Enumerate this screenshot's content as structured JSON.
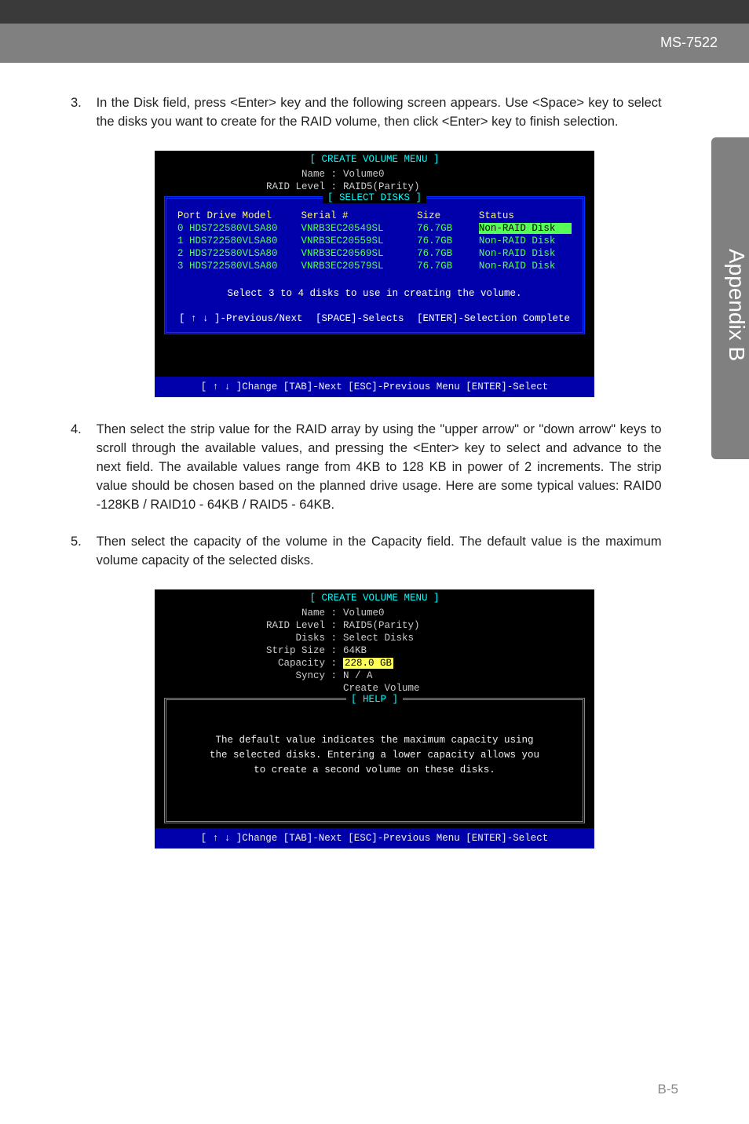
{
  "header": {
    "title": "MS-7522"
  },
  "sideTab": "Appendix B",
  "step3": {
    "num": "3.",
    "text": "In the Disk field, press <Enter> key and the following screen appears. Use <Space> key to select the disks you want to create for the RAID volume, then click <Enter> key to finish selection."
  },
  "bios1": {
    "title": "[ CREATE VOLUME MENU ]",
    "fields": [
      {
        "label": "Name :",
        "value": "Volume0"
      },
      {
        "label": "RAID Level :",
        "value": "RAID5(Parity)"
      }
    ],
    "selectTitle": "[ SELECT DISKS ]",
    "headers": {
      "port": "Port Drive Model",
      "serial": "Serial #",
      "size": "Size",
      "status": "Status"
    },
    "rows": [
      {
        "port": "0 HDS722580VLSA80",
        "serial": "VNRB3EC20549SL",
        "size": "76.7GB",
        "status": "Non-RAID Disk",
        "hl": true
      },
      {
        "port": "1 HDS722580VLSA80",
        "serial": "VNRB3EC20559SL",
        "size": "76.7GB",
        "status": "Non-RAID Disk",
        "hl": false
      },
      {
        "port": "2 HDS722580VLSA80",
        "serial": "VNRB3EC20569SL",
        "size": "76.7GB",
        "status": "Non-RAID Disk",
        "hl": false
      },
      {
        "port": "3 HDS722580VLSA80",
        "serial": "VNRB3EC20579SL",
        "size": "76.7GB",
        "status": "Non-RAID Disk",
        "hl": false
      }
    ],
    "message": "Select 3 to 4 disks to use in creating the volume.",
    "keys": {
      "prev": "[ ↑ ↓ ]-Previous/Next",
      "space": "[SPACE]-Selects",
      "enter": "[ENTER]-Selection Complete"
    },
    "footer": "[ ↑ ↓ ]Change   [TAB]-Next   [ESC]-Previous Menu   [ENTER]-Select"
  },
  "step4": {
    "num": "4.",
    "text": "Then select the strip value for the RAID array by using the \"upper arrow\" or \"down arrow\" keys to scroll through the available values, and pressing the <Enter> key to select and advance to the next field. The available values range from 4KB to 128 KB in power of 2 increments. The strip value should be chosen based on the planned drive usage. Here are some typical values: RAID0 -128KB / RAID10 - 64KB / RAID5 - 64KB."
  },
  "step5": {
    "num": "5.",
    "text": "Then select the capacity of the volume in the Capacity field. The default value is the maximum volume capacity of the selected disks."
  },
  "bios2": {
    "title": "[ CREATE VOLUME MENU ]",
    "fields": [
      {
        "label": "Name :",
        "value": "Volume0"
      },
      {
        "label": "RAID Level :",
        "value": "RAID5(Parity)"
      },
      {
        "label": "Disks :",
        "value": "Select Disks"
      },
      {
        "label": "Strip Size :",
        "value": "64KB"
      },
      {
        "label": "Capacity :",
        "value": "228.0  GB",
        "hl": true
      },
      {
        "label": "Syncy :",
        "value": "N / A"
      },
      {
        "label": "",
        "value": "Create Volume"
      }
    ],
    "helpTitle": "[ HELP ]",
    "helpText": "The default value indicates the maximum  capacity using the selected disks.  Entering a lower capacity allows you to create a second volume on these disks.",
    "footer": "[ ↑ ↓ ]Change   [TAB]-Next   [ESC]-Previous Menu   [ENTER]-Select"
  },
  "pageNum": "B-5"
}
